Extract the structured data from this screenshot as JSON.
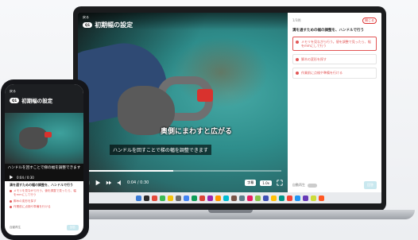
{
  "app": {
    "back_label": "戻る",
    "lesson_badge": "Q1",
    "title": "初期幅の設定"
  },
  "video": {
    "overlay_caption": "奥側にまわすと広がる",
    "subtitle": "ハンドルを回すことで梯の幅を調整できます",
    "progress_percent": 45,
    "time": "0:04 / 0:30",
    "settings_label": "字幕",
    "speed_label": "1.0x"
  },
  "quiz": {
    "counter": "1/3問",
    "close_label": "閉じる",
    "question": "溝を通すための幅の調整を、ハンドルで行う",
    "options": [
      "メモリを見ながら行う。値を調整で見ったら、幅をmmにして行う",
      "脚木の変形を探す",
      "作業前に点検や準備を行ける"
    ],
    "toggle_label": "自動再生",
    "submit_label": "回答"
  },
  "dock": {
    "colors": [
      "#3a7bd5",
      "#2b2b2b",
      "#e24b3b",
      "#3cba54",
      "#f4c20d",
      "#6d6d6d",
      "#4285f4",
      "#0f9d58",
      "#db4437",
      "#9c27b0",
      "#ff9800",
      "#00bcd4",
      "#795548",
      "#607d8b",
      "#e91e63",
      "#8bc34a",
      "#3f51b5",
      "#ffc107",
      "#009688",
      "#f44336",
      "#2196f3",
      "#673ab7",
      "#cddc39",
      "#ff5722"
    ]
  }
}
